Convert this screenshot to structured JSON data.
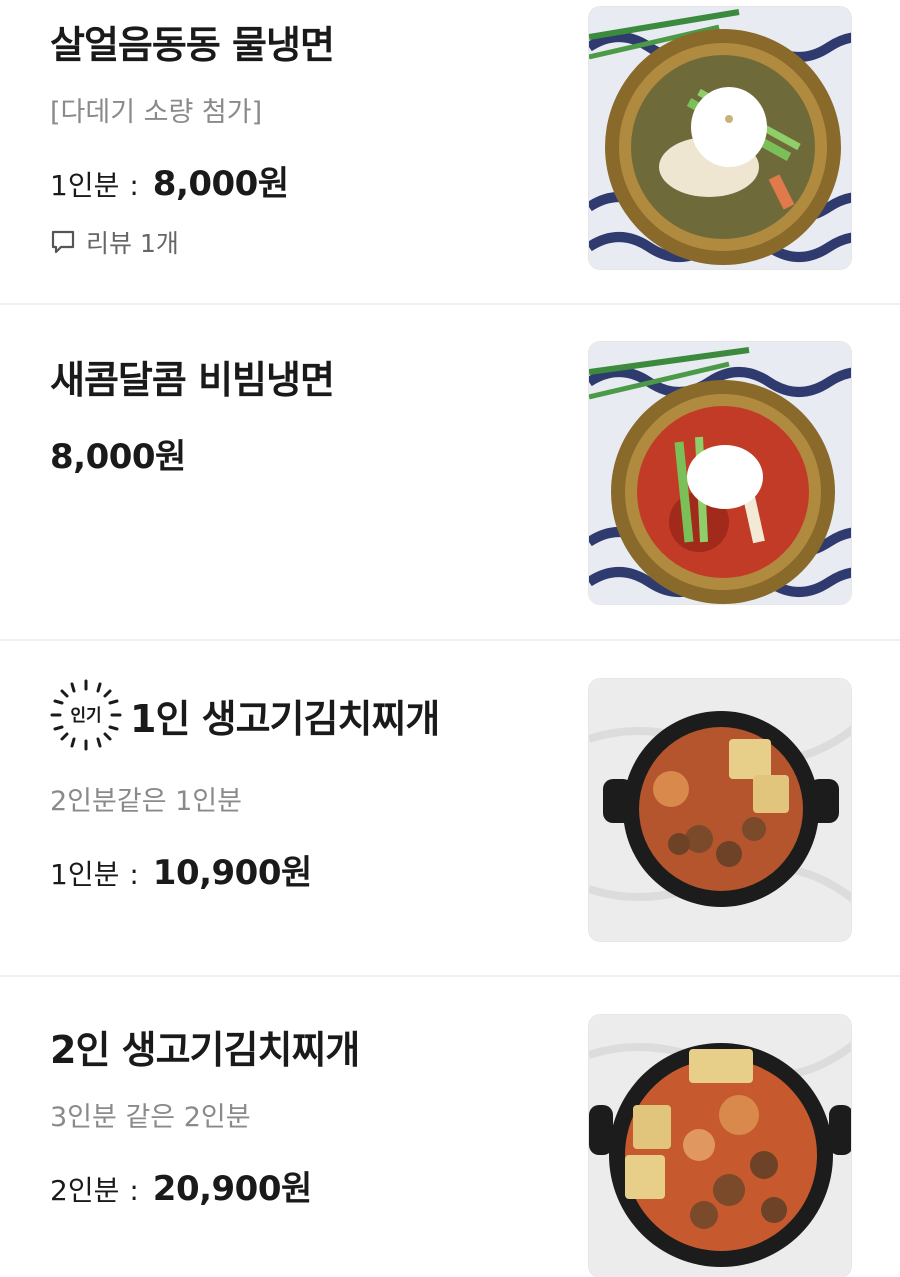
{
  "items": [
    {
      "name": "살얼음동동 물냉면",
      "description": "[다데기 소량 첨가]",
      "price_label": "1인분",
      "price_separator": ":",
      "price": "8,000원",
      "review_text": "리뷰 1개",
      "image_icon": "cold-noodle-image"
    },
    {
      "name": "새콤달콤 비빔냉면",
      "price": "8,000원",
      "image_icon": "bibim-noodle-image"
    },
    {
      "badge_label": "인기",
      "name": "1인 생고기김치찌개",
      "description": "2인분같은 1인분",
      "price_label": "1인분",
      "price_separator": ":",
      "price": "10,900원",
      "image_icon": "kimchi-stew-image"
    },
    {
      "name": "2인 생고기김치찌개",
      "description": "3인분 같은 2인분",
      "price_label": "2인분",
      "price_separator": ":",
      "price": "20,900원",
      "image_icon": "kimchi-stew-image"
    }
  ],
  "colors": {
    "text": "#1a1a1a",
    "muted": "#8a8a8a",
    "divider": "#f0f0f0"
  }
}
